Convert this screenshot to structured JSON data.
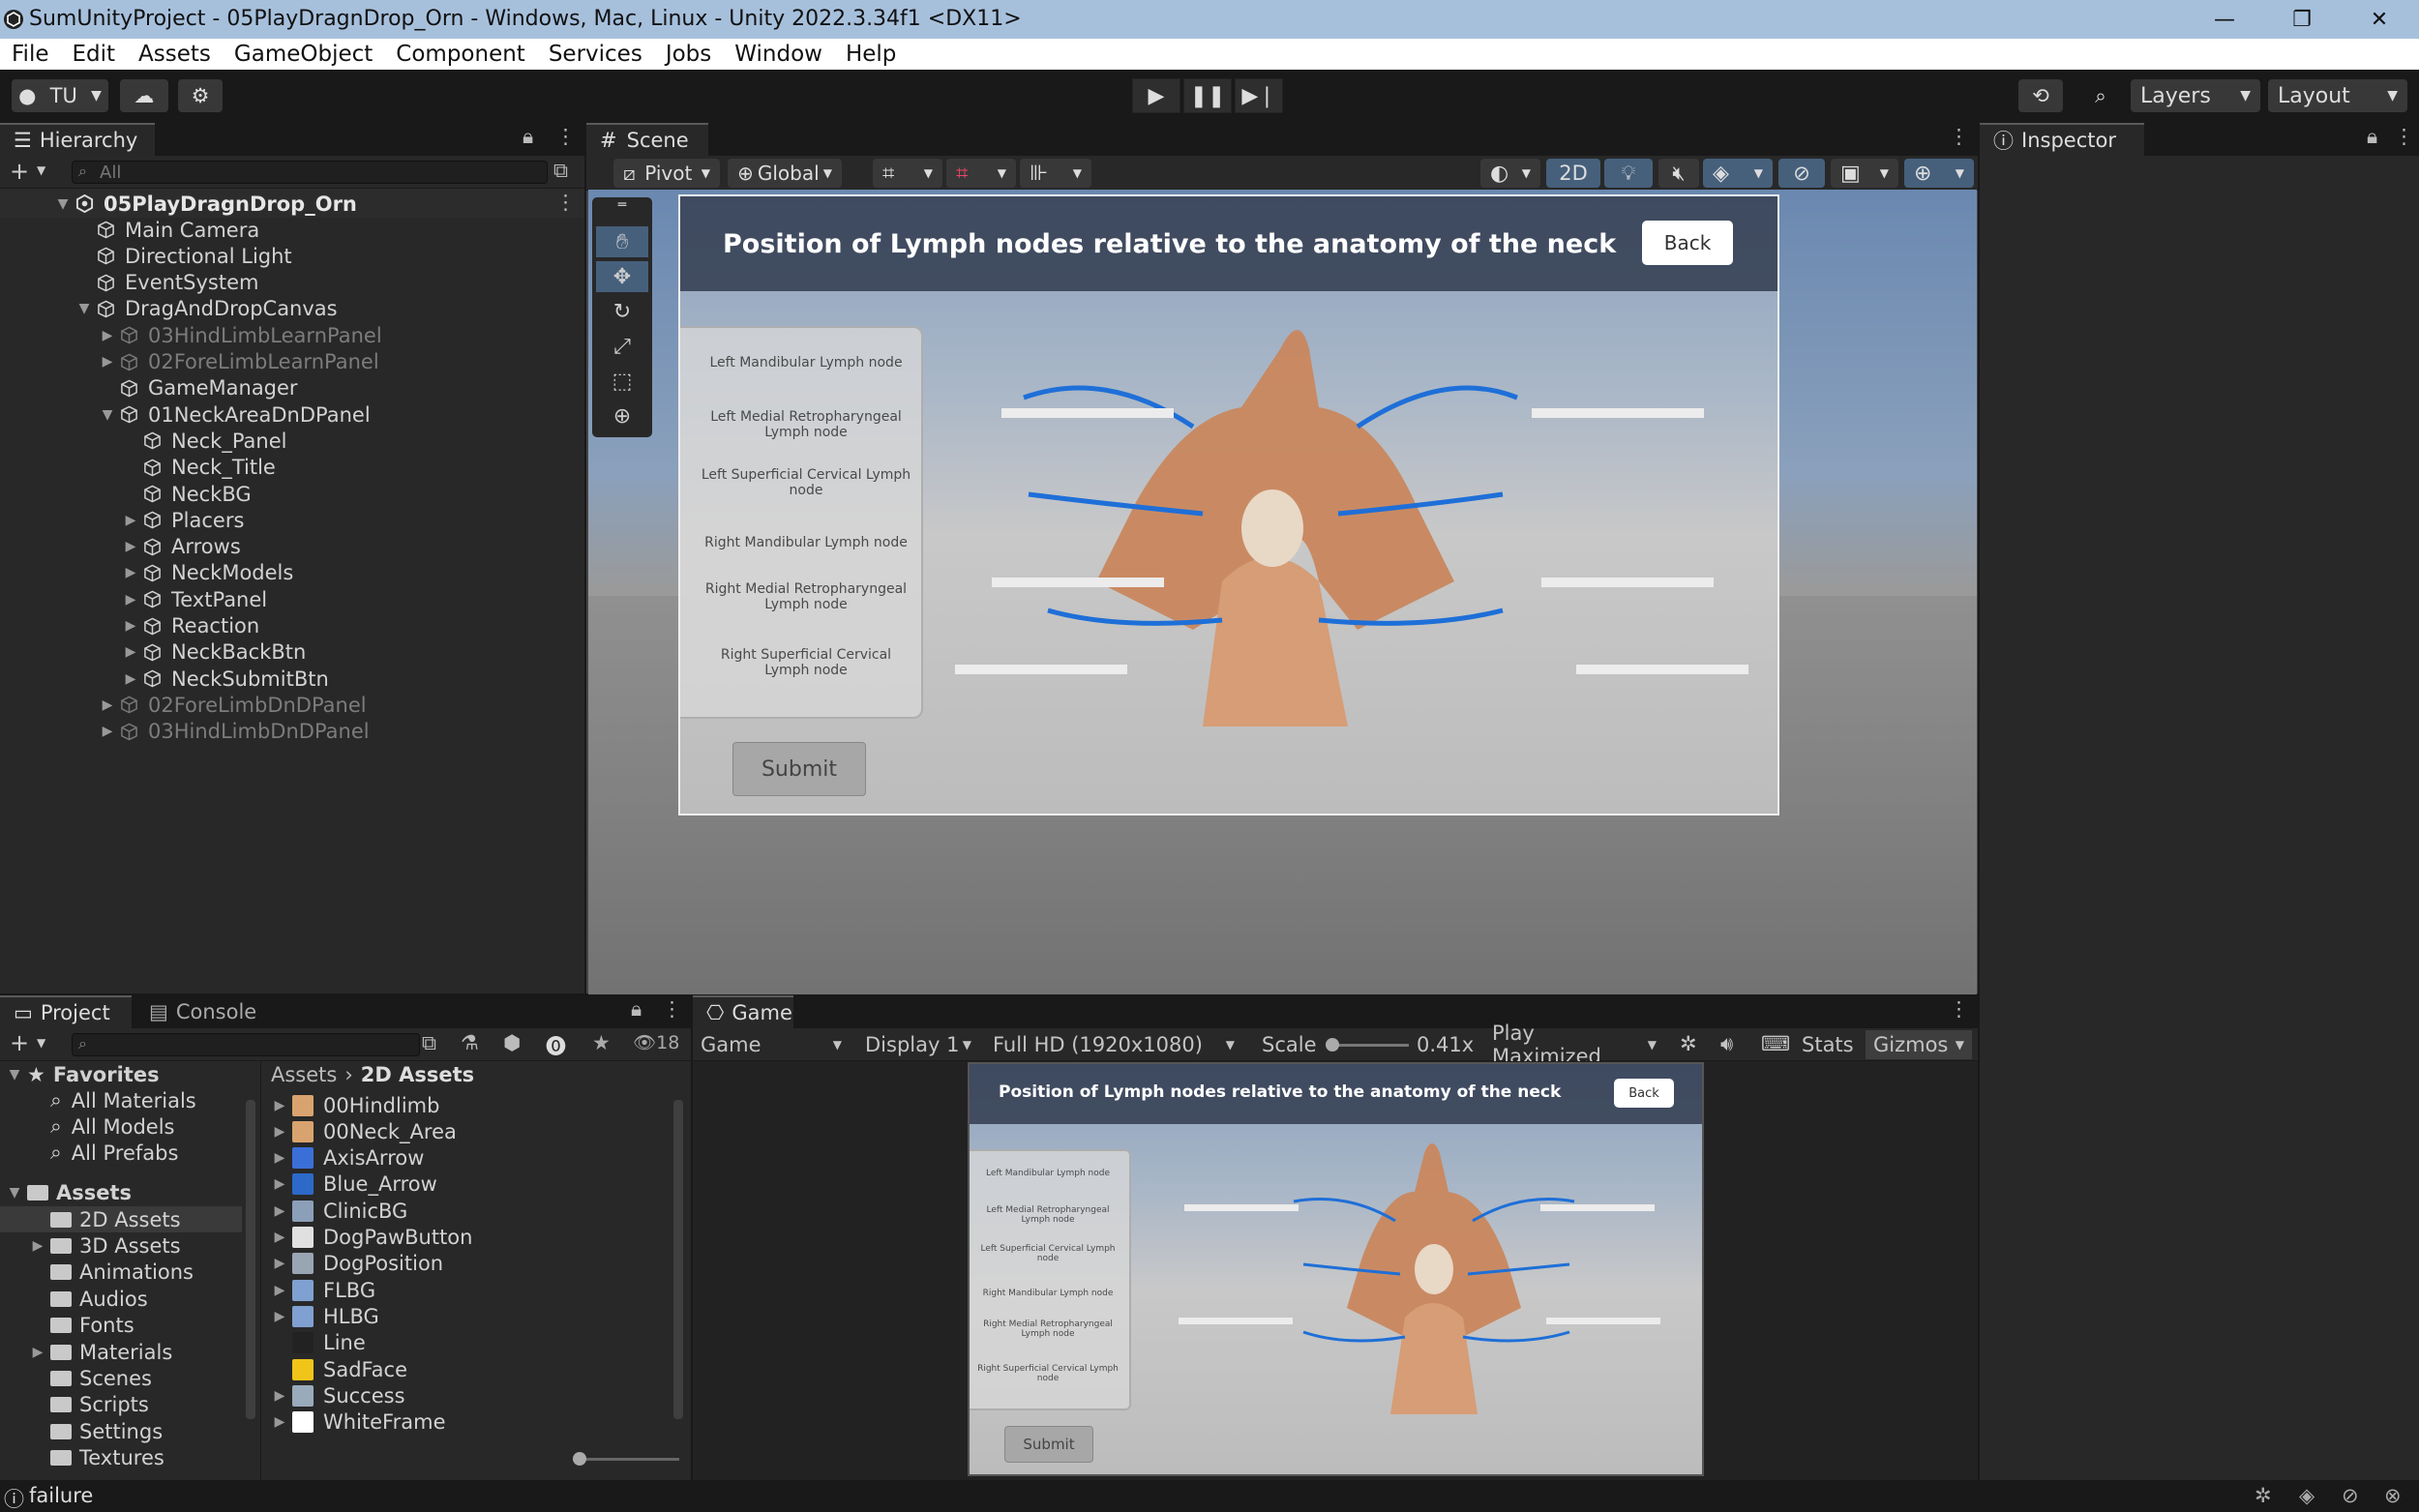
{
  "window": {
    "title": "SumUnityProject - 05PlayDragnDrop_Orn - Windows, Mac, Linux - Unity 2022.3.34f1 <DX11>",
    "minimize": "—",
    "maximize": "❐",
    "close": "✕"
  },
  "menu": [
    "File",
    "Edit",
    "Assets",
    "GameObject",
    "Component",
    "Services",
    "Jobs",
    "Window",
    "Help"
  ],
  "toolbar": {
    "account": "TU",
    "layers": "Layers",
    "layout": "Layout"
  },
  "hierarchy": {
    "tab": "Hierarchy",
    "search_placeholder": "All",
    "scene_name": "05PlayDragnDrop_Orn",
    "items": [
      {
        "label": "Main Camera"
      },
      {
        "label": "Directional Light"
      },
      {
        "label": "EventSystem"
      },
      {
        "label": "DragAndDropCanvas"
      },
      {
        "label": "03HindLimbLearnPanel"
      },
      {
        "label": "02ForeLimbLearnPanel"
      },
      {
        "label": "GameManager"
      },
      {
        "label": "01NeckAreaDnDPanel"
      },
      {
        "label": "Neck_Panel"
      },
      {
        "label": "Neck_Title"
      },
      {
        "label": "NeckBG"
      },
      {
        "label": "Placers"
      },
      {
        "label": "Arrows"
      },
      {
        "label": "NeckModels"
      },
      {
        "label": "TextPanel"
      },
      {
        "label": "Reaction"
      },
      {
        "label": "NeckBackBtn"
      },
      {
        "label": "NeckSubmitBtn"
      },
      {
        "label": "02ForeLimbDnDPanel"
      },
      {
        "label": "03HindLimbDnDPanel"
      }
    ]
  },
  "scene": {
    "tab": "Scene",
    "pivot": "Pivot",
    "global": "Global",
    "mode_2d": "2D"
  },
  "inspector": {
    "tab": "Inspector"
  },
  "ui_canvas": {
    "title": "Position of Lymph nodes relative to the anatomy of the neck",
    "back": "Back",
    "submit": "Submit",
    "labels": [
      "Left Mandibular Lymph node",
      "Left Medial Retropharyngeal Lymph node",
      "Left Superficial Cervical Lymph node",
      "Right Mandibular Lymph node",
      "Right Medial Retropharyngeal Lymph node",
      "Right Superficial Cervical Lymph node"
    ]
  },
  "project": {
    "tab_project": "Project",
    "tab_console": "Console",
    "count": "18",
    "favorites": "Favorites",
    "fav_items": [
      "All Materials",
      "All Models",
      "All Prefabs"
    ],
    "assets": "Assets",
    "asset_folders": [
      "2D Assets",
      "3D Assets",
      "Animations",
      "Audios",
      "Fonts",
      "Materials",
      "Scenes",
      "Scripts",
      "Settings",
      "Textures"
    ],
    "breadcrumb_root": "Assets",
    "breadcrumb_current": "2D Assets",
    "files": [
      "00Hindlimb",
      "00Neck_Area",
      "AxisArrow",
      "Blue_Arrow",
      "ClinicBG",
      "DogPawButton",
      "DogPosition",
      "FLBG",
      "HLBG",
      "Line",
      "SadFace",
      "Success",
      "WhiteFrame"
    ]
  },
  "game": {
    "tab": "Game",
    "mode": "Game",
    "display": "Display 1",
    "resolution": "Full HD (1920x1080)",
    "scale_label": "Scale",
    "scale_value": "0.41x",
    "play_mode": "Play Maximized",
    "stats": "Stats",
    "gizmos": "Gizmos"
  },
  "status": {
    "message": "failure"
  }
}
